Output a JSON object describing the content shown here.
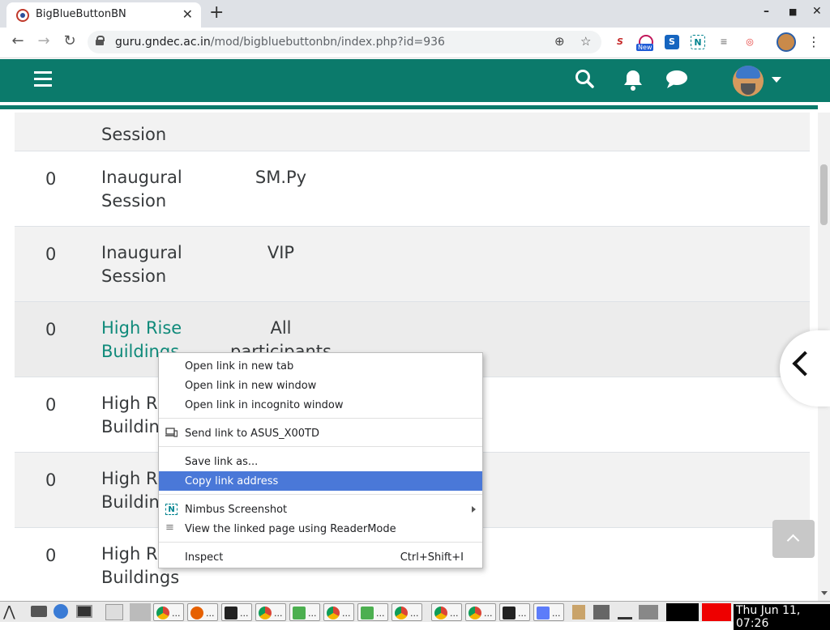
{
  "browser": {
    "tab_title": "BigBlueButtonBN",
    "url_host": "guru.gndec.ac.in",
    "url_path": "/mod/bigbluebuttonbn/index.php?id=936",
    "new_badge": "New"
  },
  "colors": {
    "moodle_teal": "#0b7a6b",
    "link_teal": "#0f8a7a",
    "menu_highlight": "#4a78d8"
  },
  "navbar": {
    "icons": [
      "menu-icon",
      "search-icon",
      "bell-icon",
      "chat-icon"
    ]
  },
  "table": {
    "partial_top": {
      "name_line2": "Session"
    },
    "rows": [
      {
        "count": "0",
        "name_line1": "Inaugural",
        "name_line2": "Session",
        "role": "SM.Py",
        "link": false
      },
      {
        "count": "0",
        "name_line1": "Inaugural",
        "name_line2": "Session",
        "role": "VIP",
        "link": false
      },
      {
        "count": "0",
        "name_line1": "High Rise",
        "name_line2": "Buildings",
        "role_line1": "All",
        "role_line2": "participants",
        "link": true
      },
      {
        "count": "0",
        "name_line1": "High Ri",
        "name_line2": "Buildin",
        "role": "",
        "link": false
      },
      {
        "count": "0",
        "name_line1": "High Ri",
        "name_line2": "Buildin",
        "role": "",
        "link": false
      },
      {
        "count": "0",
        "name_line1": "High Ri",
        "name_line2": "Buildings",
        "role": "",
        "link": false
      }
    ]
  },
  "context_menu": {
    "items": [
      {
        "label": "Open link in new tab"
      },
      {
        "label": "Open link in new window"
      },
      {
        "label": "Open link in incognito window"
      },
      {
        "label": "Send link to ASUS_X00TD"
      },
      {
        "label": "Save link as..."
      },
      {
        "label": "Copy link address"
      },
      {
        "label": "Nimbus Screenshot"
      },
      {
        "label": "View the linked page using ReaderMode"
      },
      {
        "label": "Inspect",
        "shortcut": "Ctrl+Shift+I"
      }
    ]
  },
  "taskbar": {
    "clock": "Thu Jun 11, 07:26",
    "task_label": "..."
  }
}
